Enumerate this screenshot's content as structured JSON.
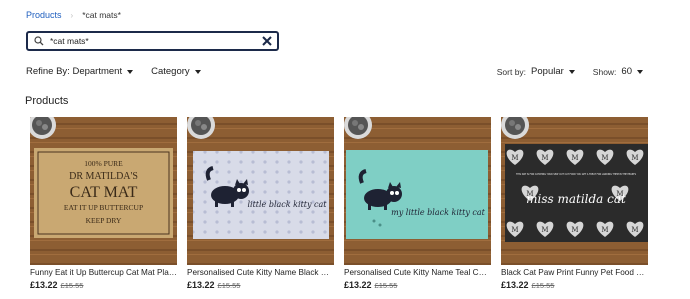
{
  "breadcrumb": {
    "root": "Products",
    "current": "*cat mats*"
  },
  "search": {
    "value": "*cat mats*"
  },
  "filters": {
    "refine_label": "Refine By: Department",
    "category_label": "Category"
  },
  "sort": {
    "sort_label": "Sort by:",
    "sort_value": "Popular",
    "show_label": "Show:",
    "show_value": "60"
  },
  "section": {
    "title": "Products"
  },
  "products": [
    {
      "name": "Funny Eat it Up Buttercup Cat Mat Place...",
      "price": "£13.22",
      "was": "£15.55",
      "mat_lines": [
        "100% PURE",
        "DR MATILDA'S",
        "CAT MAT",
        "EAT IT UP BUTTERCUP",
        "KEEP DRY"
      ]
    },
    {
      "name": "Personalised Cute Kitty Name Black Cat ...",
      "price": "£13.22",
      "was": "£15.55",
      "mat_text": "little black kitty cat"
    },
    {
      "name": "Personalised Cute Kitty Name Teal Cat Pl...",
      "price": "£13.22",
      "was": "£15.55",
      "mat_text": "my little black kitty cat"
    },
    {
      "name": "Black Cat Paw Print Funny Pet Food Plac...",
      "price": "£13.22",
      "was": "£15.55",
      "mat_text": "miss matilda cat",
      "mat_small": "THIS MAT IS FOR CATCHING YOUR SPAT OUT CAT FOOD YOU GET A TREAT FOR LANDING THEM IN THE HEARTS",
      "heart_letter": "M"
    }
  ],
  "icons": {
    "search": "magnifier-icon",
    "clear": "close-icon",
    "caret": "caret-down-icon"
  },
  "colors": {
    "link": "#1f5fbf",
    "search_border": "#1c2a4a",
    "wood": "#9a6a3a"
  }
}
